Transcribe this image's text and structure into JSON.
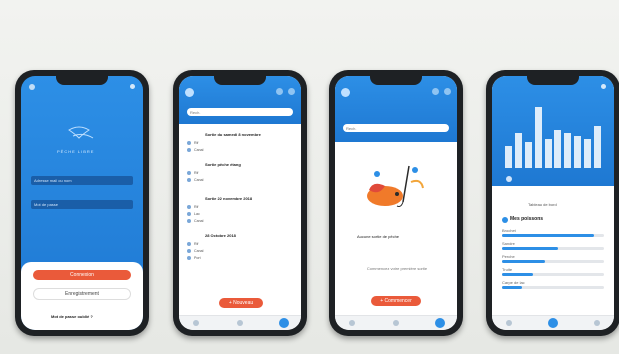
{
  "phone1": {
    "brand": "PÊCHE LIBRE",
    "email_placeholder": "Adresse mail ou nom",
    "password_placeholder": "Mot de passe",
    "login_button": "Connexion",
    "register_button": "Enregistrement",
    "forgot_link": "Mot de passe oublié ?"
  },
  "phone2": {
    "search_placeholder": "Rech.",
    "sections": [
      {
        "title": "Sortie du samedi 8 novembre",
        "rows": [
          "Rif",
          "Canal",
          "Port"
        ]
      },
      {
        "title": "Sortie pêche étang",
        "rows": [
          "Rif",
          "Canal"
        ]
      },
      {
        "title": "Sortie 22 novembre 2018",
        "rows": [
          "Rif",
          "Lac",
          "Canal"
        ]
      },
      {
        "title": "28 Octobre 2018",
        "rows": [
          "Rif",
          "Canal",
          "Port"
        ]
      }
    ],
    "new_button": "+ Nouveau"
  },
  "phone3": {
    "search_placeholder": "Rech.",
    "empty_title": "Aucune sortie de pêche",
    "empty_sub": "Commencez votre première sortie",
    "start_button": "+ Commencer"
  },
  "phone4": {
    "chart_data": {
      "type": "bar",
      "values": [
        0.35,
        0.55,
        0.4,
        0.95,
        0.45,
        0.6,
        0.55,
        0.5,
        0.45,
        0.65
      ],
      "title": ""
    },
    "panel_title": "Tableau de bord",
    "fish_title": "Mes poissons",
    "fish": [
      {
        "name": "Brochet",
        "pct": 0.9
      },
      {
        "name": "Sandre",
        "pct": 0.55
      },
      {
        "name": "Perche",
        "pct": 0.42
      },
      {
        "name": "Truite",
        "pct": 0.3
      },
      {
        "name": "Carpe de lac",
        "pct": 0.2
      }
    ]
  },
  "colors": {
    "primary": "#2d8fe6",
    "accent": "#ea5a3a"
  }
}
